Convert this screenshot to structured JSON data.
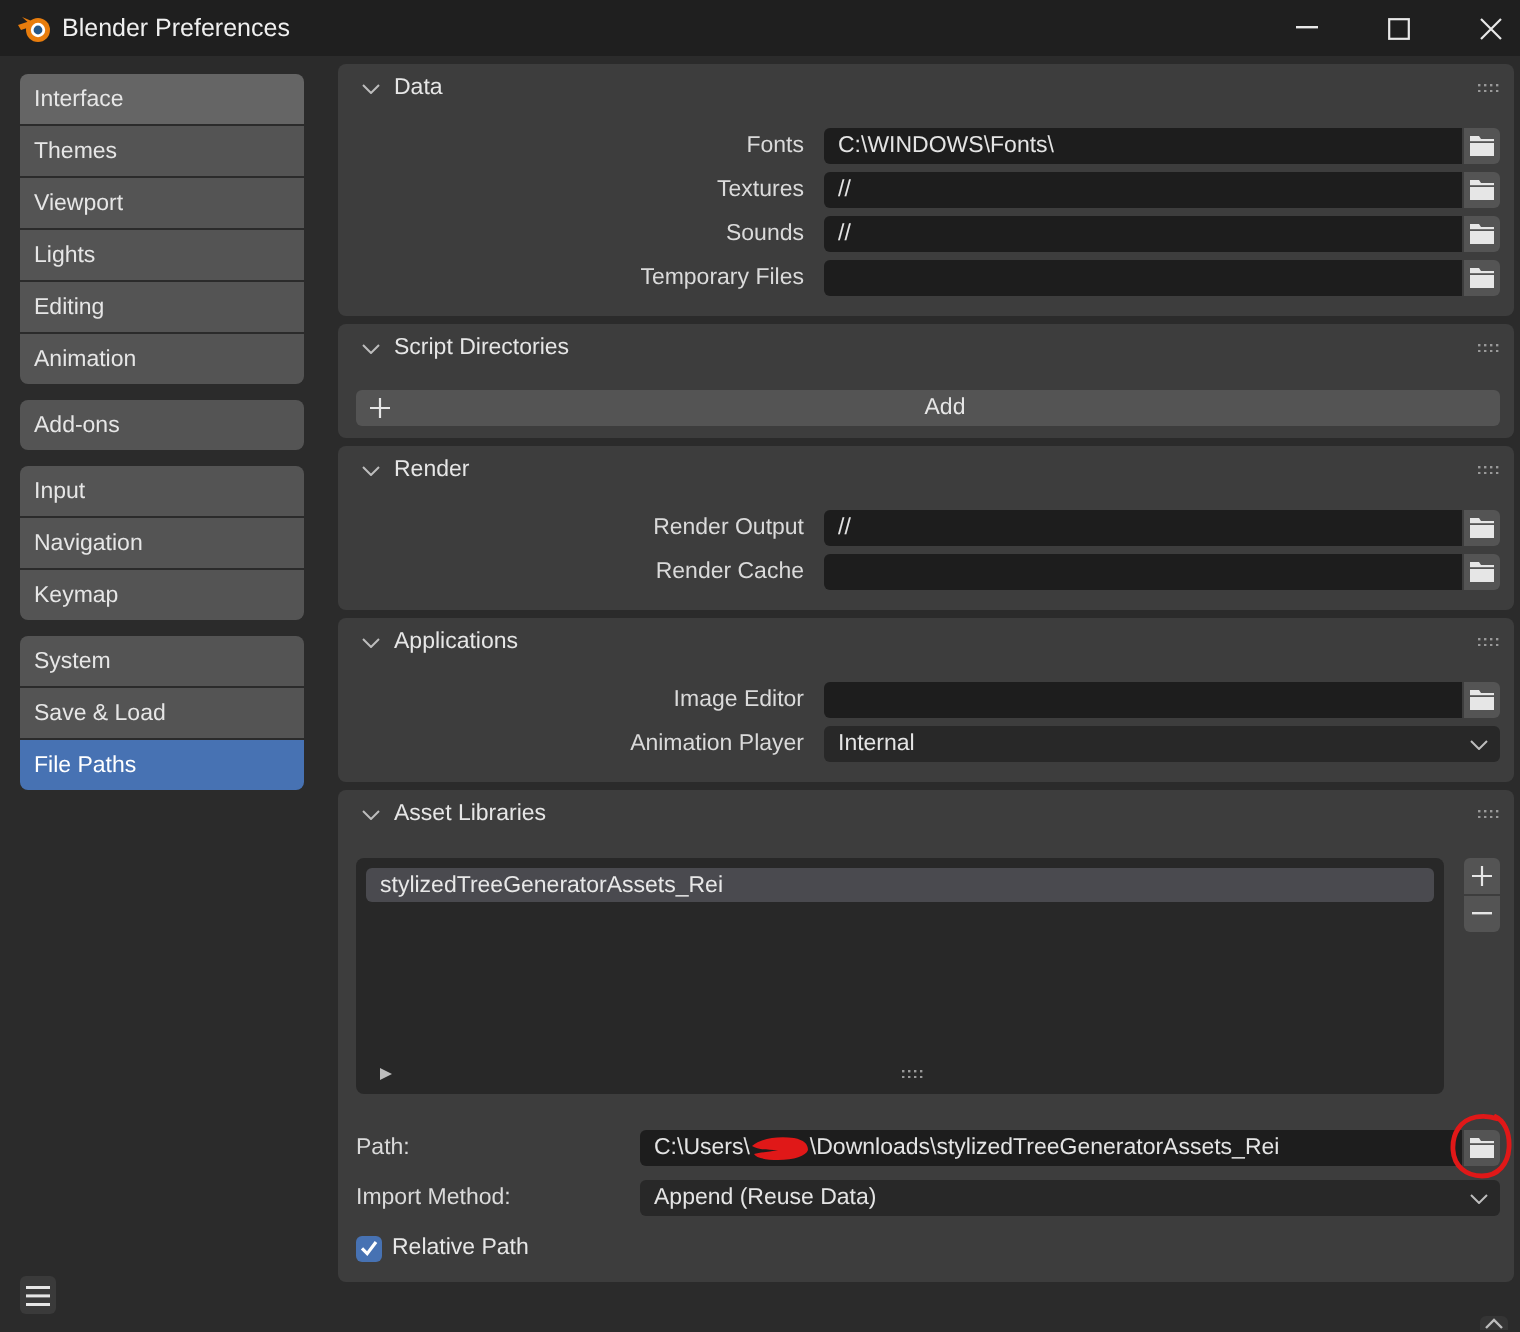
{
  "window": {
    "title": "Blender Preferences"
  },
  "sidebar": {
    "groups": [
      {
        "items": [
          {
            "label": "Interface",
            "selected": false,
            "hovered": true
          },
          {
            "label": "Themes",
            "selected": false,
            "hovered": false
          },
          {
            "label": "Viewport",
            "selected": false,
            "hovered": false
          },
          {
            "label": "Lights",
            "selected": false,
            "hovered": false
          },
          {
            "label": "Editing",
            "selected": false,
            "hovered": false
          },
          {
            "label": "Animation",
            "selected": false,
            "hovered": false
          }
        ]
      },
      {
        "items": [
          {
            "label": "Add-ons",
            "selected": false,
            "hovered": false
          }
        ]
      },
      {
        "items": [
          {
            "label": "Input",
            "selected": false,
            "hovered": false
          },
          {
            "label": "Navigation",
            "selected": false,
            "hovered": false
          },
          {
            "label": "Keymap",
            "selected": false,
            "hovered": false
          }
        ]
      },
      {
        "items": [
          {
            "label": "System",
            "selected": false,
            "hovered": false
          },
          {
            "label": "Save & Load",
            "selected": false,
            "hovered": false
          },
          {
            "label": "File Paths",
            "selected": true,
            "hovered": false
          }
        ]
      }
    ]
  },
  "panels": [
    {
      "kind": "form",
      "title": "Data",
      "expanded": true,
      "rows": [
        {
          "kind": "path",
          "label": "Fonts",
          "value": "C:\\WINDOWS\\Fonts\\"
        },
        {
          "kind": "path",
          "label": "Textures",
          "value": "//"
        },
        {
          "kind": "path",
          "label": "Sounds",
          "value": "//"
        },
        {
          "kind": "path",
          "label": "Temporary Files"
        }
      ]
    },
    {
      "kind": "button",
      "title": "Script Directories",
      "expanded": true,
      "button": {
        "label": "Add"
      }
    },
    {
      "kind": "form",
      "title": "Render",
      "expanded": true,
      "rows": [
        {
          "kind": "path",
          "label": "Render Output",
          "value": "//"
        },
        {
          "kind": "path",
          "label": "Render Cache"
        }
      ]
    },
    {
      "kind": "form",
      "title": "Applications",
      "expanded": true,
      "rows": [
        {
          "kind": "path",
          "label": "Image Editor"
        },
        {
          "kind": "dropdown",
          "label": "Animation Player",
          "value": "Internal"
        }
      ]
    },
    {
      "kind": "library",
      "title": "Asset Libraries",
      "expanded": true,
      "libraries": [
        {
          "name": "stylizedTreeGeneratorAssets_Rei",
          "selected": true
        }
      ],
      "details": [
        {
          "kind": "path",
          "label": "Path:",
          "value_parts": [
            "C:\\Users\\",
            "\\Downloads\\stylizedTreeGeneratorAssets_Rei"
          ],
          "redacted": true,
          "circled": true
        },
        {
          "kind": "dropdown",
          "label": "Import Method:",
          "value": "Append (Reuse Data)"
        },
        {
          "kind": "checkbox",
          "label": "Relative Path",
          "checked": true
        }
      ]
    }
  ]
}
